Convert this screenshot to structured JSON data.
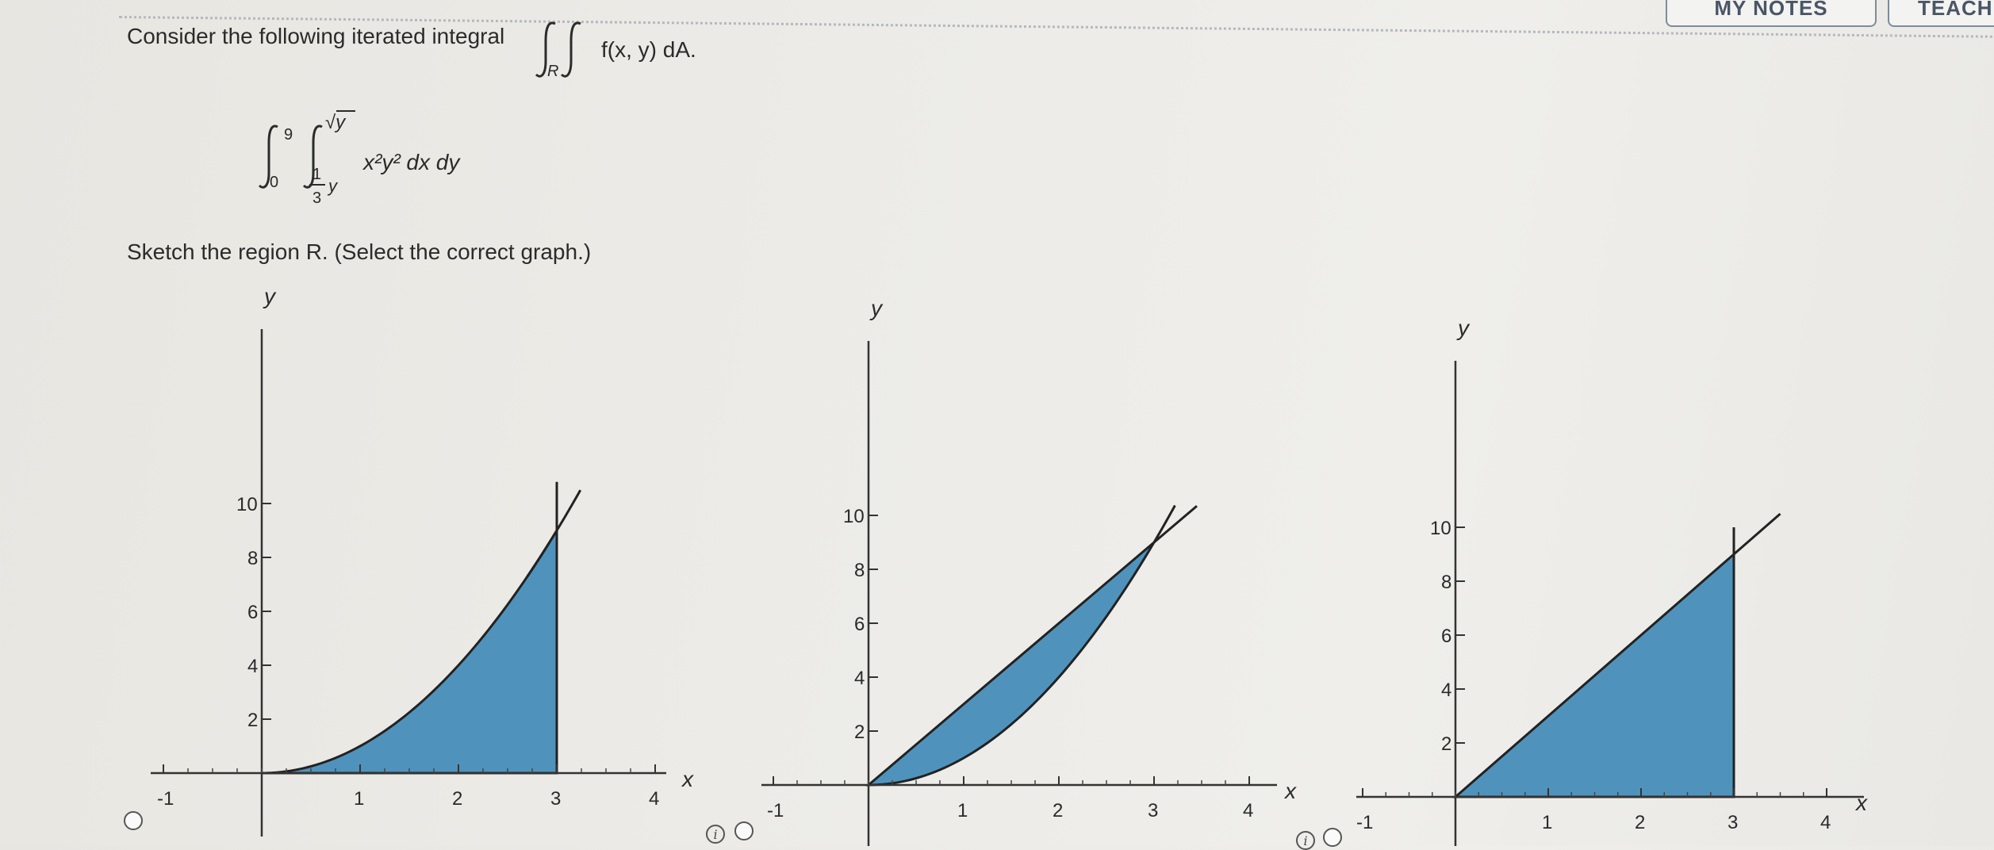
{
  "header": {
    "notes_button": "MY NOTES",
    "ask_button": "ASK YOUR TEACHER"
  },
  "question": {
    "intro": "Consider the following iterated integral",
    "integral_sub": "R",
    "integrand_general": "f(x, y) dA.",
    "outer_lower": "0",
    "outer_upper": "9",
    "inner_lower_num": "1",
    "inner_lower_den": "3",
    "inner_lower_var": "y",
    "inner_upper": "√y",
    "integrand": "x²y² dx dy",
    "instruction": "Sketch the region R. (Select the correct graph.)"
  },
  "graphs": [
    {
      "id": "a",
      "x_ticks": [
        "-1",
        "1",
        "2",
        "3",
        "4"
      ],
      "y_ticks": [
        "2",
        "4",
        "6",
        "8",
        "10"
      ],
      "x_label": "x",
      "y_label": "y",
      "fill_color": "#4f93bd"
    },
    {
      "id": "b",
      "x_ticks": [
        "-1",
        "1",
        "2",
        "3",
        "4"
      ],
      "y_ticks": [
        "2",
        "4",
        "6",
        "8",
        "10"
      ],
      "x_label": "x",
      "y_label": "y",
      "fill_color": "#4f93bd"
    },
    {
      "id": "c",
      "x_ticks": [
        "-1",
        "1",
        "2",
        "3",
        "4"
      ],
      "y_ticks": [
        "2",
        "4",
        "6",
        "8",
        "10"
      ],
      "x_label": "x",
      "y_label": "y",
      "fill_color": "#4f93bd"
    }
  ]
}
